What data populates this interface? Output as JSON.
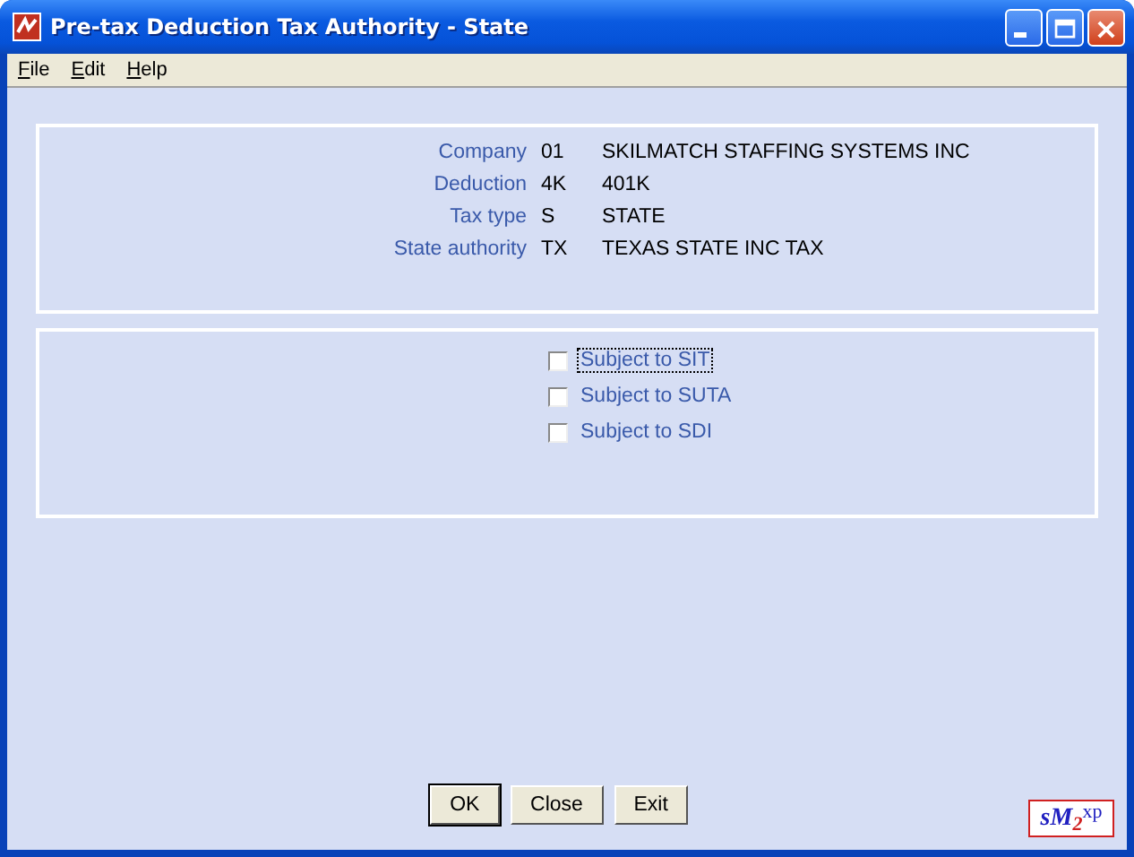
{
  "window": {
    "title": "Pre-tax Deduction Tax Authority - State"
  },
  "menu": [
    {
      "label": "File"
    },
    {
      "label": "Edit"
    },
    {
      "label": "Help"
    }
  ],
  "fields": [
    {
      "label": "Company",
      "code": "01",
      "value": "SKILMATCH STAFFING SYSTEMS INC"
    },
    {
      "label": "Deduction",
      "code": "4K",
      "value": "401K"
    },
    {
      "label": "Tax type",
      "code": "S",
      "value": "STATE"
    },
    {
      "label": "State authority",
      "code": "TX",
      "value": "TEXAS STATE INC TAX"
    }
  ],
  "checkboxes": [
    {
      "label": "Subject to SIT",
      "checked": false,
      "focused": true
    },
    {
      "label": "Subject to SUTA",
      "checked": false,
      "focused": false
    },
    {
      "label": "Subject to SDI",
      "checked": false,
      "focused": false
    }
  ],
  "buttons": [
    {
      "label": "OK",
      "default": true
    },
    {
      "label": "Close",
      "default": false
    },
    {
      "label": "Exit",
      "default": false
    }
  ],
  "logo": {
    "left": "sM",
    "sub": "2",
    "right": "xp"
  }
}
